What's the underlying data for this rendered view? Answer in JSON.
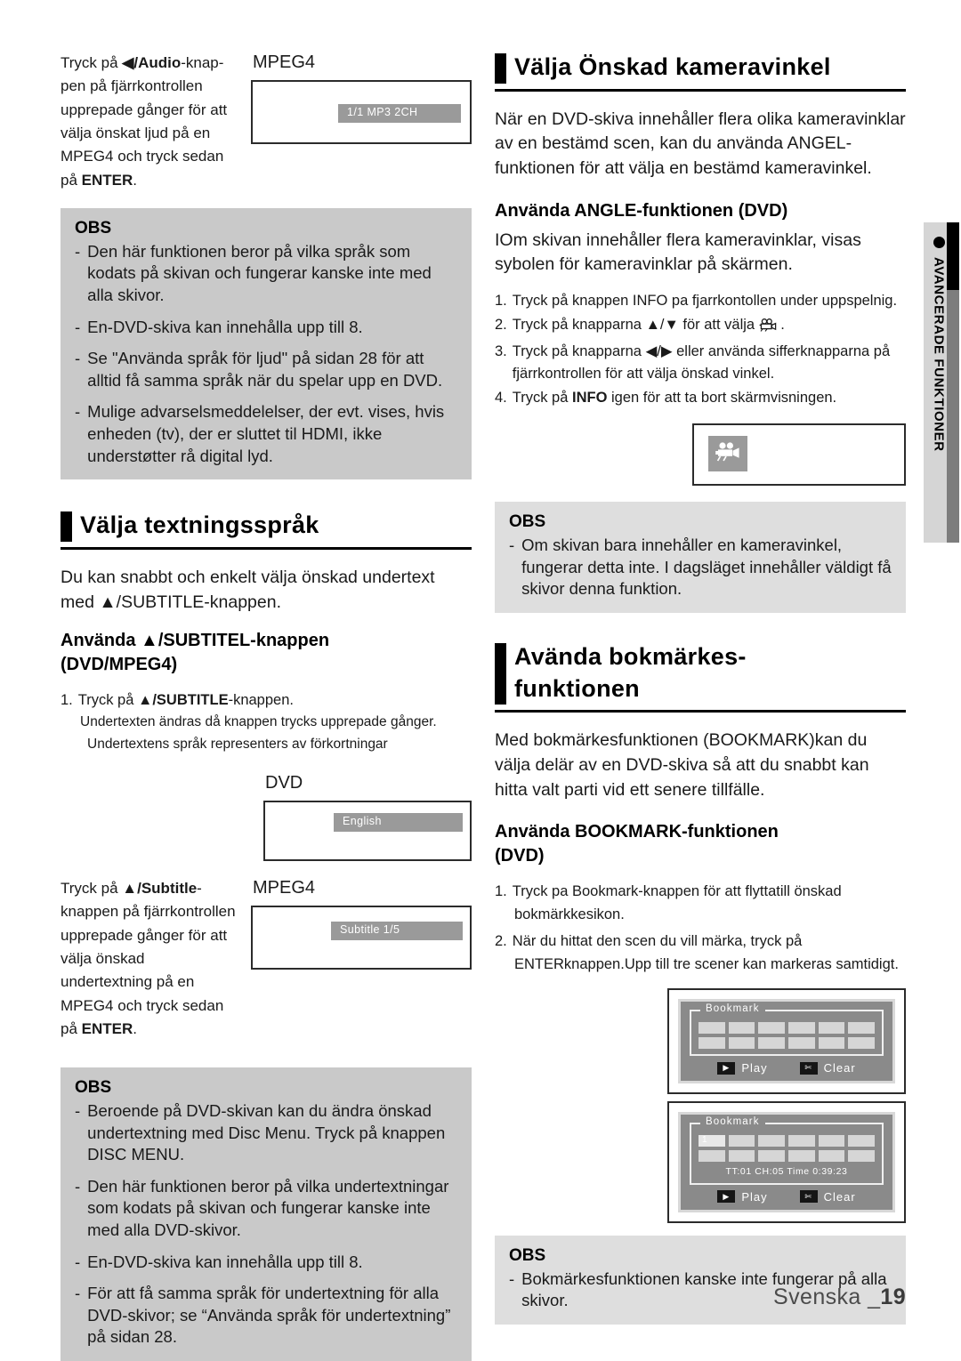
{
  "page": {
    "footer_language": "Svenska _",
    "footer_page_number": "19",
    "side_tab_label": "AVANCERADE FUNKTIONER",
    "side_tab_bullet": "bullet-dot-icon"
  },
  "left_column": {
    "audio_caption": {
      "line1_pre": "Tryck på ",
      "line1_key": "◀/Audio",
      "line1_post": "-knap-",
      "rest": "pen på fjärrkontrollen upprepade gånger för att välja önskat ljud på en MPEG4 och tryck sedan på ",
      "enter": "ENTER",
      "period": "."
    },
    "audio_screen": {
      "label": "MPEG4",
      "chip": "1/1 MP3 2CH"
    },
    "obs_audio": {
      "title": "OBS",
      "items": [
        "Den här funktionen beror på vilka språk som kodats på skivan och fungerar kanske inte med alla skivor.",
        "En-DVD-skiva kan innehålla upp till 8.",
        "Se \"Använda språk för ljud\" på sidan 28 för att alltid få samma språk när du spelar upp en DVD.",
        "Mulige advarselsmeddelelser, der evt. vises, hvis enheden (tv), der er sluttet til HDMI, ikke understøtter rå digital lyd."
      ]
    },
    "subtitle_section": {
      "heading": "Välja textningsspråk",
      "intro_pre": "Du kan snabbt och enkelt välja önskad undertext med ",
      "intro_key": "▲/SUBTITLE",
      "intro_post": "-knappen.",
      "sub_head_line1_pre": "Använda ",
      "sub_head_line1_key": "▲/SUBTITEL",
      "sub_head_line1_post": "-knappen",
      "sub_head_line2": "(DVD/MPEG4)",
      "step1_num": "1.",
      "step1_pre": "Tryck på ",
      "step1_key": "▲/SUBTITLE",
      "step1_post": "-knappen.",
      "step1_sub1": "Undertexten ändras då knappen trycks upprepade gånger.",
      "step1_sub2": "Undertextens språk representers av förkortningar"
    },
    "dvd_screen": {
      "label": "DVD",
      "chip": "English"
    },
    "subtitle_caption": {
      "line1_pre": "Tryck på ",
      "line1_key": "▲/Subtitle",
      "line1_post": "-",
      "rest": "knappen på fjärrkontrollen upprepade gånger för att välja önskad undertextning på en MPEG4 och tryck sedan på ",
      "enter": "ENTER",
      "period": "."
    },
    "mpeg4_subtitle_screen": {
      "label": "MPEG4",
      "chip": "Subtitle 1/5"
    },
    "obs_subtitle": {
      "title": "OBS",
      "items": [
        "Beroende på DVD-skivan kan du ändra önskad undertextning med Disc Menu. Tryck på knappen DISC MENU.",
        "Den här funktionen beror på vilka undertextningar som kodats på skivan och fungerar kanske inte med alla DVD-skivor.",
        "En-DVD-skiva kan innehålla upp till 8.",
        "För att få samma språk för undertextning för alla DVD-skivor; se “Använda språk för undertextning” på sidan 28."
      ]
    }
  },
  "right_column": {
    "angle_section": {
      "heading": "Välja Önskad kameravinkel",
      "intro": "När en DVD-skiva innehåller flera olika kameravinklar av  en bestämd scen, kan du använda ANGEL-funktionen för att välja en bestämd kameravinkel.",
      "sub_head": "Använda ANGLE-funktionen (DVD)",
      "sub_intro": "IOm skivan innehåller flera kameravinklar, visas sybolen för kameravinklar på skärmen.",
      "steps": [
        {
          "num": "1.",
          "text": "Tryck på knappen INFO pa fjarrkontollen under uppspelnig."
        },
        {
          "num": "2.",
          "text_pre": "Tryck på knapparna ▲/▼ för att välja ",
          "icon": "movie-camera-icon",
          "text_post": " ."
        },
        {
          "num": "3.",
          "text": "Tryck på knapparna ◀/▶ eller använda sifferknapparna på fjärrkontrollen för att välja önskad vinkel."
        },
        {
          "num": "4.",
          "text_pre": "Tryck på ",
          "bold": "INFO",
          "text_post": " igen för att ta bort skärmvisningen."
        }
      ]
    },
    "obs_angle": {
      "title": "OBS",
      "items": [
        "Om skivan bara innehåller en kameravinkel, fungerar detta inte. I dagsläget innehåller väldigt få skivor denna funktion."
      ]
    },
    "bookmark_section": {
      "heading_line1": "Avända bokmärkes-",
      "heading_line2": "funktionen",
      "intro": "Med bokmärkesfunktionen (BOOKMARK)kan du välja delär av en DVD-skiva så att du snabbt kan hitta valt parti vid ett senere tillfälle.",
      "sub_head_line1": "Använda BOOKMARK-funktionen",
      "sub_head_line2": "(DVD)",
      "steps": [
        {
          "num": "1.",
          "text": "Tryck pa Bookmark-knappen för att flyttatill önskad",
          "cont": "bokmärkkesikon."
        },
        {
          "num": "2.",
          "text": "När du hittat den scen du vill märka, tryck på",
          "cont": "ENTERknappen.Upp till tre scener kan markeras samtidigt."
        }
      ]
    },
    "bookmark_screen_1": {
      "legend": "Bookmark",
      "cells_row1": [
        "",
        "",
        "",
        "",
        "",
        ""
      ],
      "cells_row2": [
        "",
        "",
        "",
        "",
        "",
        ""
      ],
      "status": "",
      "play_label": "Play",
      "clear_label": "Clear",
      "play_key_icon": "play-triangle-icon",
      "clear_key_icon": "clear-icon"
    },
    "bookmark_screen_2": {
      "legend": "Bookmark",
      "cells_row1": [
        "1",
        "",
        "",
        "",
        "",
        ""
      ],
      "cells_row2": [
        "",
        "",
        "",
        "",
        "",
        ""
      ],
      "status": "TT:01 CH:05  Time 0:39:23",
      "play_label": "Play",
      "clear_label": "Clear",
      "play_key_icon": "play-triangle-icon",
      "clear_key_icon": "clear-icon"
    },
    "obs_bookmark": {
      "title": "OBS",
      "items": [
        "Bokmärkesfunktionen kanske inte fungerar på alla skivor."
      ]
    }
  }
}
